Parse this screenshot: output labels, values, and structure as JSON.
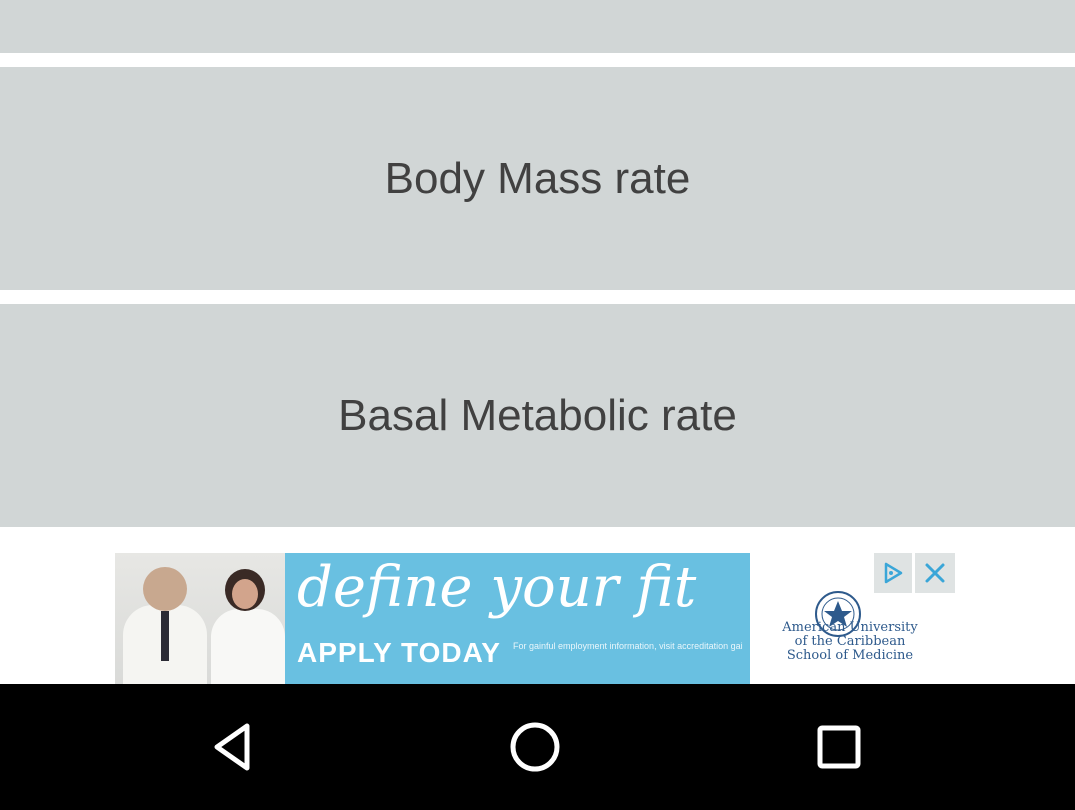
{
  "menu": {
    "items": [
      {
        "label": ""
      },
      {
        "label": "Body Mass rate"
      },
      {
        "label": "Basal Metabolic rate"
      }
    ]
  },
  "ad": {
    "headline": "define your fit",
    "cta": "APPLY TODAY",
    "fine_print": "For gainful employment information, visit accreditation gainful employment",
    "brand_lines": [
      "American University",
      "of the Caribbean",
      "School of Medicine"
    ],
    "close_icon": "close-icon",
    "choices_icon": "adchoices-icon"
  },
  "navbar": {
    "back_icon": "back-triangle-icon",
    "home_icon": "home-circle-icon",
    "recents_icon": "recents-square-icon"
  },
  "colors": {
    "tile_bg": "#d1d6d6",
    "tile_text": "#414141",
    "ad_blue": "#69c0e1",
    "brand_blue": "#2e5a8c",
    "navbar_bg": "#000000"
  }
}
